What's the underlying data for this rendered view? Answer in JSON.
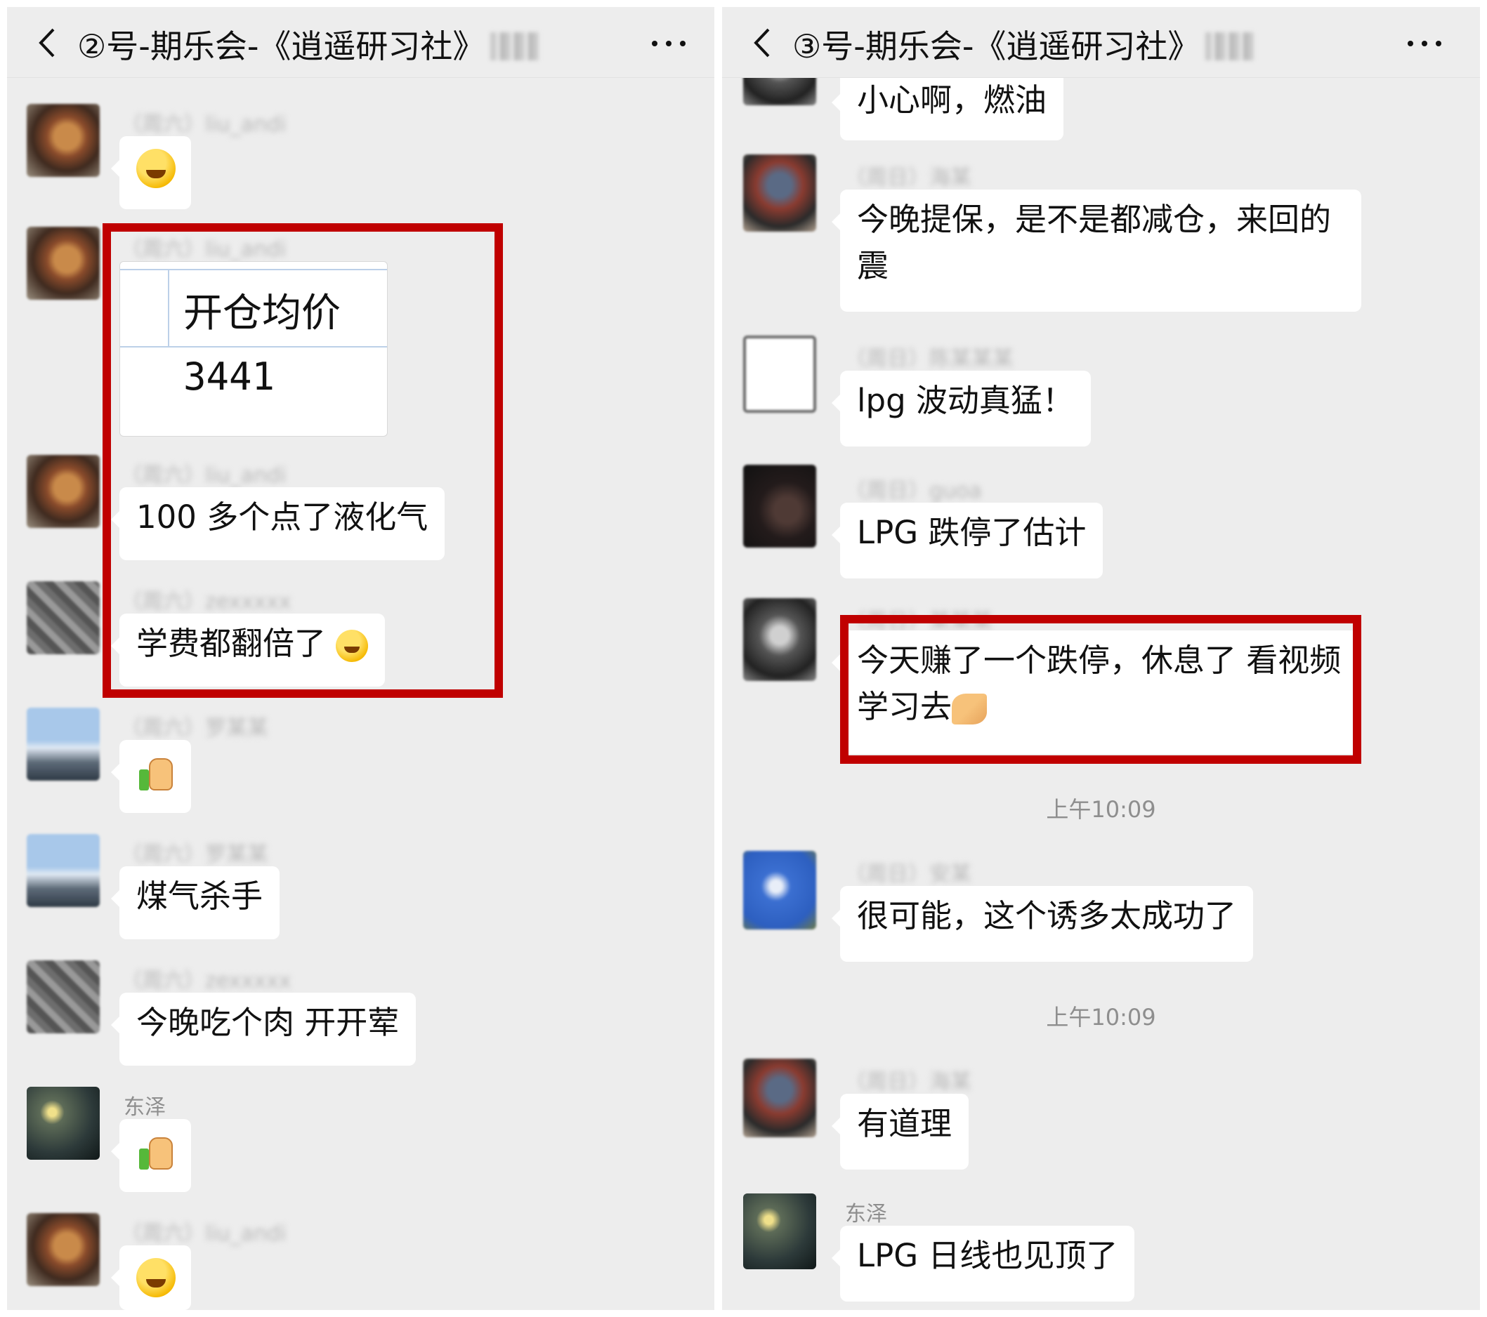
{
  "left": {
    "title": "②号-期乐会-《逍遥研习社》",
    "messages": [
      {
        "sender": "（周六）liu_andi",
        "content": "[emoji: grinning face]"
      },
      {
        "sender": "（周六）liu_andi",
        "card_label": "开仓均价",
        "card_value": "3441"
      },
      {
        "sender": "（周六）liu_andi",
        "text": "100 多个点了液化气"
      },
      {
        "sender": "（周六）zexxxxx",
        "text": "学费都翻倍了"
      },
      {
        "sender": "（周六）罗某某",
        "content": "[emoji: thumbs up]"
      },
      {
        "sender": "（周六）罗某某",
        "text": "煤气杀手"
      },
      {
        "sender": "（周六）zexxxxx",
        "text": "今晚吃个肉 开开荤"
      },
      {
        "sender": "东泽",
        "content": "[emoji: thumbs up]"
      },
      {
        "sender": "（周六）liu_andi",
        "content": "[emoji: smirking face]"
      }
    ]
  },
  "right": {
    "title": "③号-期乐会-《逍遥研习社》",
    "messages": [
      {
        "text": "小心啊，燃油"
      },
      {
        "sender": "（周日）海某",
        "text": "今晚提保，是不是都减仓，来回的震"
      },
      {
        "sender": "（周日）陈某某某",
        "text": "lpg 波动真猛！"
      },
      {
        "sender": "（周日）guoa",
        "text": "LPG 跌停了估计"
      },
      {
        "sender": "（周日）某某某",
        "text": "今天赚了一个跌停，休息了 看视频学习去"
      },
      {
        "sender": "（周日）安某",
        "text": "很可能，这个诱多太成功了"
      },
      {
        "sender": "（周日）海某",
        "text": "有道理"
      },
      {
        "sender": "东泽",
        "text": "LPG 日线也见顶了"
      }
    ],
    "timestamps": [
      "上午10:09",
      "上午10:09"
    ]
  },
  "colors": {
    "chat_background": "#ededed",
    "bubble": "#ffffff",
    "highlight": "#c00000",
    "meta_text": "#8e8e8e"
  },
  "icons": [
    "back-arrow-icon",
    "more-dots-icon"
  ]
}
